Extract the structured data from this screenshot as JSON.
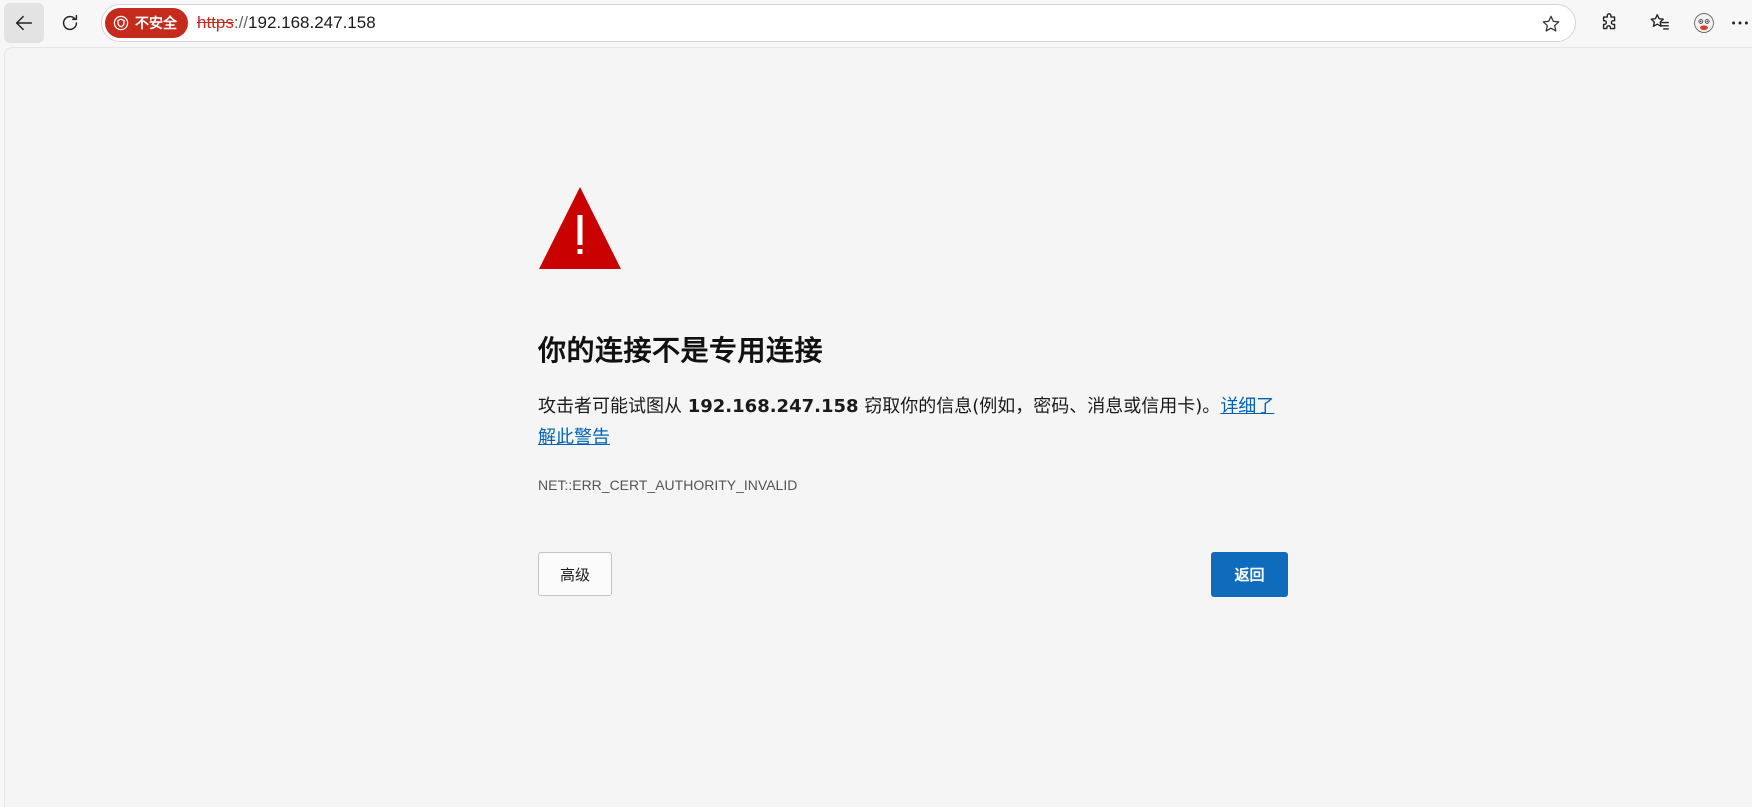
{
  "browser": {
    "address_bar": {
      "security_label": "不安全",
      "url_scheme": "https",
      "url_separator": "://",
      "url_host": "192.168.247.158"
    },
    "icons": {
      "back": "back-arrow-icon",
      "reload": "reload-icon",
      "security": "shield-warning-icon",
      "favorite": "star-icon",
      "extensions": "puzzle-icon",
      "favorites": "favorites-list-icon",
      "profile": "avatar",
      "more": "more-icon"
    }
  },
  "page": {
    "title": "你的连接不是专用连接",
    "description_prefix": "攻击者可能试图从 ",
    "description_host": "192.168.247.158",
    "description_suffix": " 窃取你的信息(例如，密码、消息或信用卡)。",
    "learn_more_link": "详细了解此警告",
    "error_code": "NET::ERR_CERT_AUTHORITY_INVALID",
    "advanced_button": "高级",
    "back_button": "返回"
  },
  "colors": {
    "danger": "#c42b1c",
    "link": "#0062b3",
    "primary_button": "#0f6cbd",
    "background": "#f5f5f5"
  }
}
